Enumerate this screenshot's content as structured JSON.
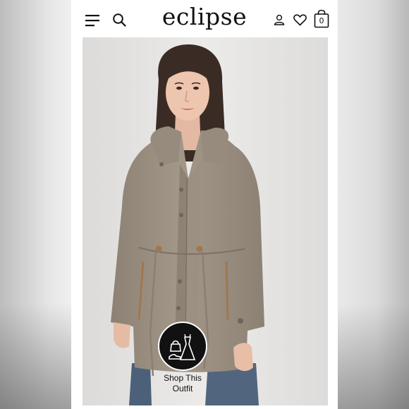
{
  "header": {
    "brand": "eclipse",
    "icons": [
      "hamburger-menu-icon",
      "search-icon",
      "user-account-icon",
      "heart-icon",
      "shopping-bag-icon"
    ],
    "bag_count": "0"
  },
  "product": {
    "image": "woman-in-taupe-hooded-anorak-jacket"
  },
  "shop_outfit": {
    "label_line1": "Shop This",
    "label_line2": "Outfit",
    "icon": "shoes-bag-dress-icon"
  },
  "colors": {
    "jacket": "#9a8e80",
    "background": "#e7e6e4",
    "text": "#111111"
  }
}
